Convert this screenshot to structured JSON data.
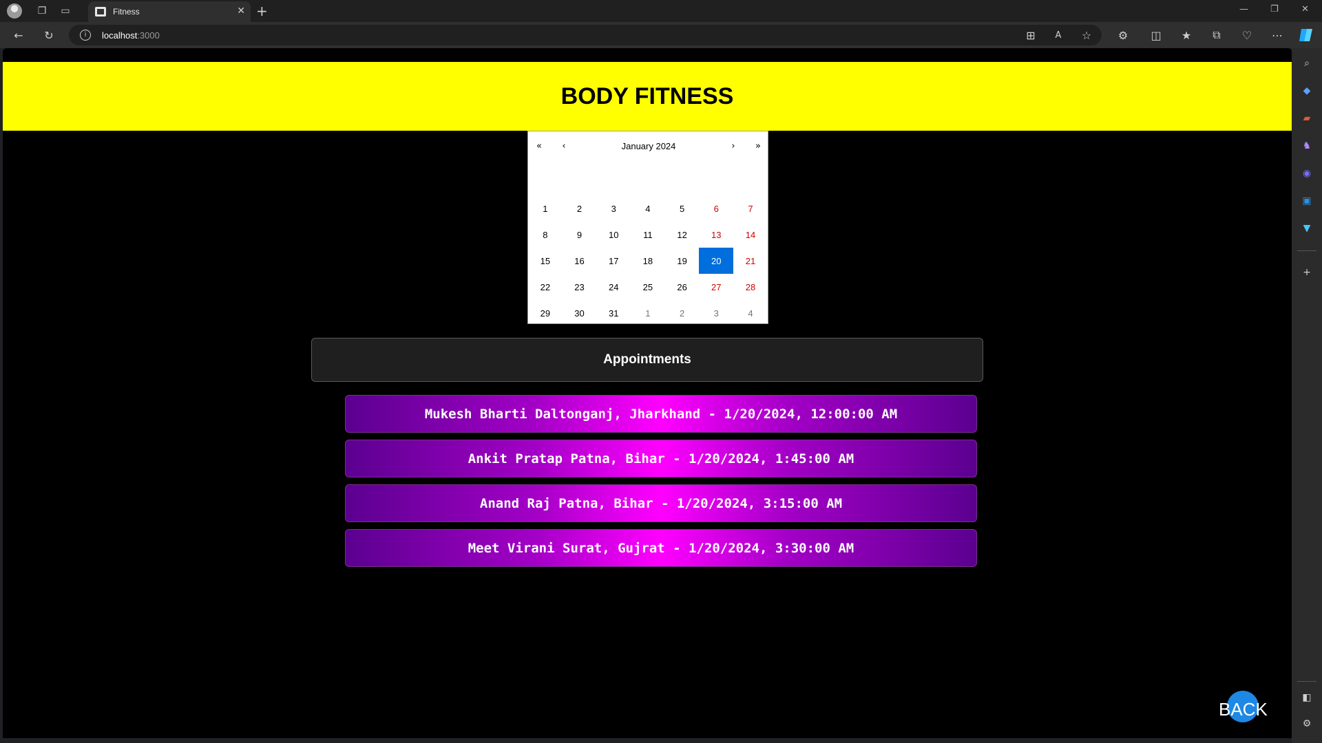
{
  "browser": {
    "tab_title": "Fitness",
    "url_host": "localhost",
    "url_port": ":3000"
  },
  "page": {
    "title": "BODY FITNESS",
    "calendar": {
      "month_label": "January 2024",
      "nav": {
        "prev_year": "«",
        "prev_month": "‹",
        "next_month": "›",
        "next_year": "»"
      },
      "selected_day": "20",
      "days": [
        {
          "label": "1",
          "type": "normal"
        },
        {
          "label": "2",
          "type": "normal"
        },
        {
          "label": "3",
          "type": "normal"
        },
        {
          "label": "4",
          "type": "normal"
        },
        {
          "label": "5",
          "type": "normal"
        },
        {
          "label": "6",
          "type": "weekend"
        },
        {
          "label": "7",
          "type": "weekend"
        },
        {
          "label": "8",
          "type": "normal"
        },
        {
          "label": "9",
          "type": "normal"
        },
        {
          "label": "10",
          "type": "normal"
        },
        {
          "label": "11",
          "type": "normal"
        },
        {
          "label": "12",
          "type": "normal"
        },
        {
          "label": "13",
          "type": "weekend"
        },
        {
          "label": "14",
          "type": "weekend"
        },
        {
          "label": "15",
          "type": "normal"
        },
        {
          "label": "16",
          "type": "normal"
        },
        {
          "label": "17",
          "type": "normal"
        },
        {
          "label": "18",
          "type": "normal"
        },
        {
          "label": "19",
          "type": "normal"
        },
        {
          "label": "20",
          "type": "active"
        },
        {
          "label": "21",
          "type": "weekend"
        },
        {
          "label": "22",
          "type": "normal"
        },
        {
          "label": "23",
          "type": "normal"
        },
        {
          "label": "24",
          "type": "normal"
        },
        {
          "label": "25",
          "type": "normal"
        },
        {
          "label": "26",
          "type": "normal"
        },
        {
          "label": "27",
          "type": "weekend"
        },
        {
          "label": "28",
          "type": "weekend"
        },
        {
          "label": "29",
          "type": "normal"
        },
        {
          "label": "30",
          "type": "normal"
        },
        {
          "label": "31",
          "type": "normal"
        },
        {
          "label": "1",
          "type": "neighbor"
        },
        {
          "label": "2",
          "type": "neighbor"
        },
        {
          "label": "3",
          "type": "neighbor"
        },
        {
          "label": "4",
          "type": "neighbor"
        }
      ]
    },
    "appointments_heading": "Appointments",
    "appointments": [
      "Mukesh Bharti Daltonganj, Jharkhand - 1/20/2024, 12:00:00 AM",
      "Ankit Pratap Patna, Bihar - 1/20/2024, 1:45:00 AM",
      "Anand Raj Patna, Bihar - 1/20/2024, 3:15:00 AM",
      "Meet Virani Surat, Gujrat - 1/20/2024, 3:30:00 AM"
    ],
    "back_label": "BACK"
  },
  "colors": {
    "header_bg": "#ffff00",
    "page_bg": "#000000",
    "selected_day_bg": "#006edc",
    "weekend_text": "#d10000",
    "appointment_gradient_center": "#ff00ff",
    "appointment_gradient_edge": "#5b0090",
    "back_button_bg": "#1e88e5"
  }
}
